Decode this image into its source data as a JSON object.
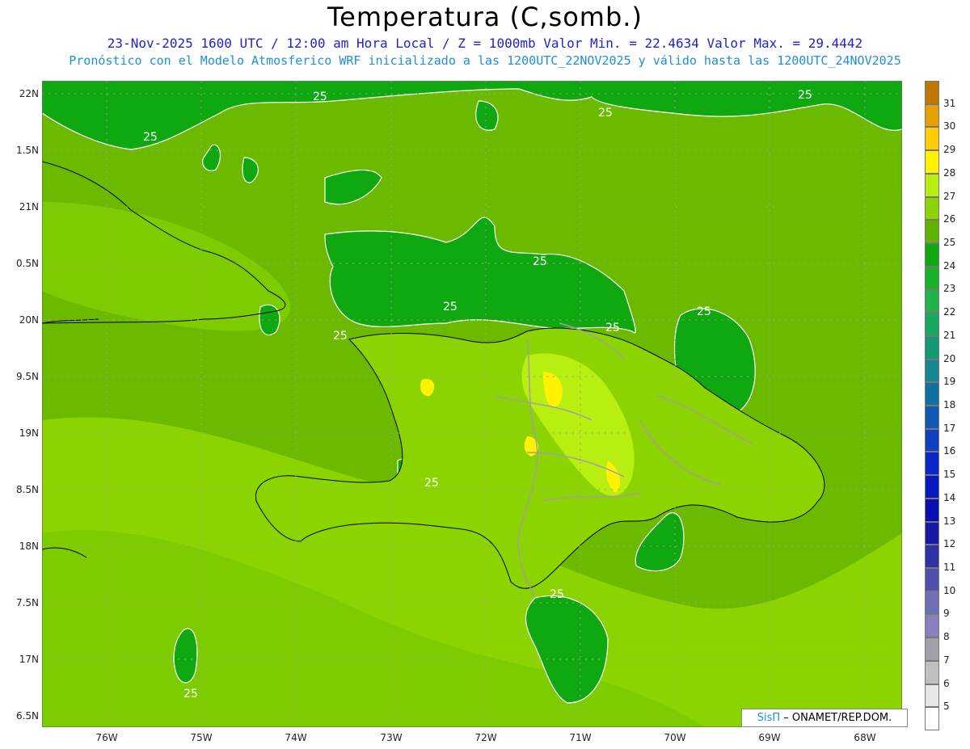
{
  "title": "Temperatura (C,somb.)",
  "subtitle_line1": "23-Nov-2025 1600 UTC / 12:00 am Hora Local / Z = 1000mb  Valor Min. = 22.4634  Valor Max. = 29.4442",
  "subtitle_line2": "Pronóstico con el Modelo Atmosferico WRF inicializado a las 1200UTC_22NOV2025 y válido hasta las  1200UTC_24NOV2025",
  "y_axis_labels": [
    "22N",
    "1.5N",
    "21N",
    "0.5N",
    "20N",
    "9.5N",
    "19N",
    "8.5N",
    "18N",
    "7.5N",
    "17N",
    "6.5N"
  ],
  "x_axis_labels": [
    "76W",
    "75W",
    "74W",
    "73W",
    "72W",
    "71W",
    "70W",
    "69W",
    "68W"
  ],
  "contour_label": "25",
  "colorbar": {
    "labels": [
      "31",
      "30",
      "29",
      "28",
      "27",
      "26",
      "25",
      "24",
      "23",
      "22",
      "21",
      "20",
      "19",
      "18",
      "17",
      "16",
      "15",
      "14",
      "13",
      "12",
      "11",
      "10",
      "9",
      "8",
      "7",
      "6",
      "5"
    ],
    "colors": [
      "#c07800",
      "#e8a000",
      "#ffcc00",
      "#fff200",
      "#b8ee10",
      "#8cd400",
      "#60b400",
      "#10a810",
      "#1ab22a",
      "#20b448",
      "#18a860",
      "#139878",
      "#138890",
      "#1070a0",
      "#0f5ab4",
      "#0f40c0",
      "#0a28c8",
      "#0818c0",
      "#0810b0",
      "#1818a8",
      "#3030a8",
      "#5050b0",
      "#7070b8",
      "#8a80c0",
      "#a0a0a8",
      "#c0c0c0",
      "#e6e6e6"
    ]
  },
  "credit": {
    "brand": "SisΠ",
    "text": " – ONAMET/REP.DOM."
  },
  "legend_colors": {
    "sea_base": "#8cd400",
    "sea_dark": "#60b400",
    "cool_25": "#10a810",
    "warm_27": "#b8ee10",
    "hot_28": "#fff200",
    "border_gray": "#a0a0a0"
  }
}
